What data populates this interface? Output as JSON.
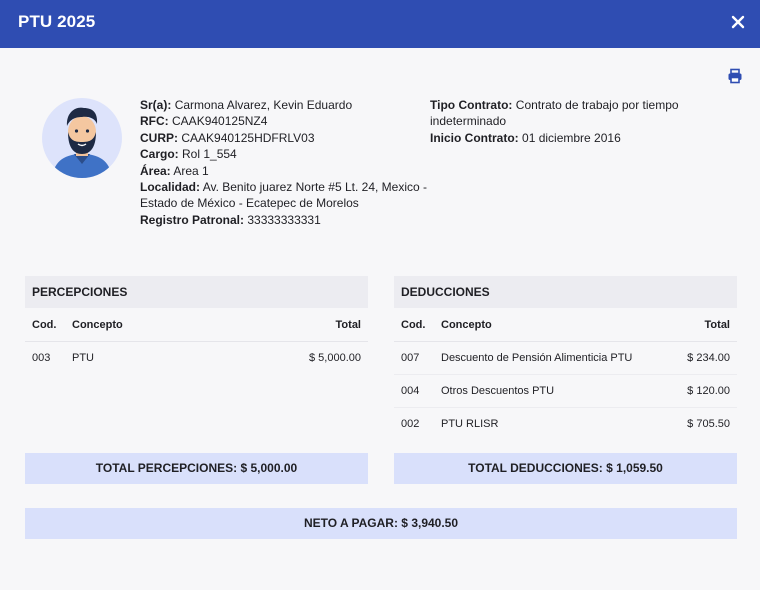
{
  "header": {
    "title": "PTU 2025"
  },
  "employee": {
    "name_label": "Sr(a):",
    "name": "Carmona Alvarez, Kevin Eduardo",
    "rfc_label": "RFC:",
    "rfc": "CAAK940125NZ4",
    "curp_label": "CURP:",
    "curp": "CAAK940125HDFRLV03",
    "cargo_label": "Cargo:",
    "cargo": "Rol 1_554",
    "area_label": "Área:",
    "area": "Area 1",
    "localidad_label": "Localidad:",
    "localidad": "Av. Benito juarez Norte #5 Lt. 24, Mexico - Estado de México - Ecatepec de Morelos",
    "registro_label": "Registro Patronal:",
    "registro": "33333333331",
    "tipo_contrato_label": "Tipo Contrato:",
    "tipo_contrato": "Contrato de trabajo por tiempo indeterminado",
    "inicio_label": "Inicio Contrato:",
    "inicio": "01 diciembre 2016"
  },
  "percepciones": {
    "title": "PERCEPCIONES",
    "headers": {
      "cod": "Cod.",
      "concepto": "Concepto",
      "total": "Total"
    },
    "rows": [
      {
        "cod": "003",
        "concepto": "PTU",
        "total": "$ 5,000.00"
      }
    ],
    "total_label": "TOTAL PERCEPCIONES: $ 5,000.00"
  },
  "deducciones": {
    "title": "DEDUCCIONES",
    "headers": {
      "cod": "Cod.",
      "concepto": "Concepto",
      "total": "Total"
    },
    "rows": [
      {
        "cod": "007",
        "concepto": "Descuento de Pensión Alimenticia PTU",
        "total": "$ 234.00"
      },
      {
        "cod": "004",
        "concepto": "Otros Descuentos PTU",
        "total": "$ 120.00"
      },
      {
        "cod": "002",
        "concepto": "PTU RLISR",
        "total": "$ 705.50"
      }
    ],
    "total_label": "TOTAL DEDUCCIONES: $ 1,059.50"
  },
  "neto": {
    "label": "NETO A PAGAR: $ 3,940.50"
  },
  "icons": {
    "close": "close-icon",
    "print": "printer-icon",
    "avatar": "avatar"
  },
  "colors": {
    "header": "#2f4db2",
    "summary_bar": "#d9e0fb",
    "panel_title": "#ececf1"
  }
}
